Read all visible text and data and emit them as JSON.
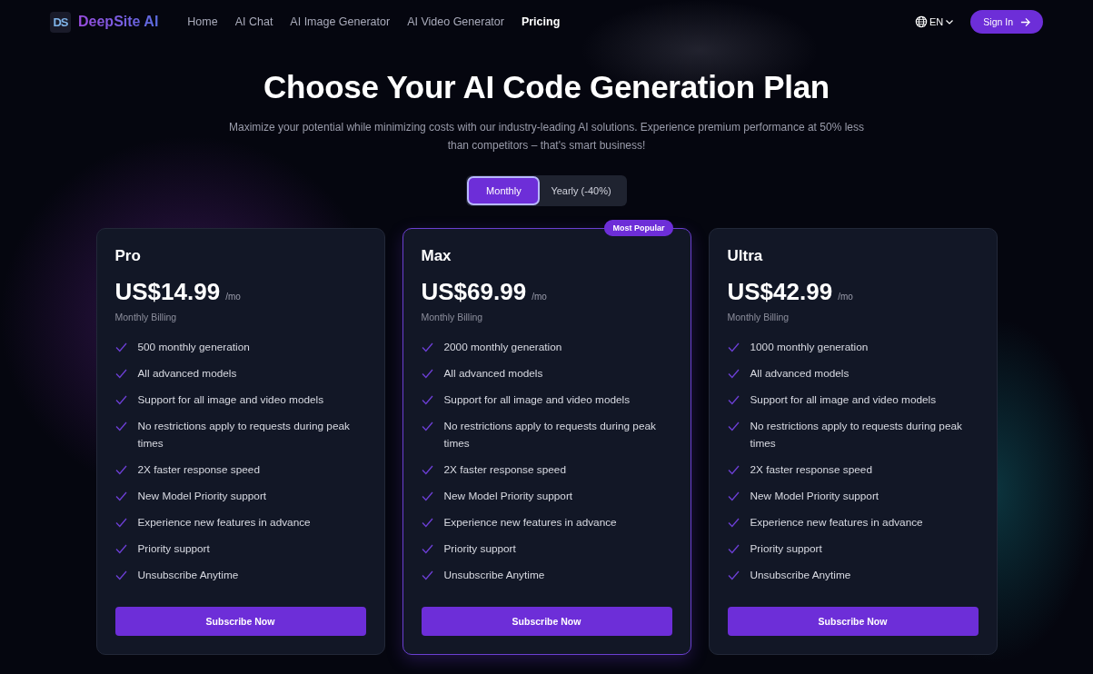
{
  "header": {
    "brand": "DeepSite AI",
    "logo_text": "DS",
    "nav": [
      {
        "label": "Home",
        "selected": false
      },
      {
        "label": "AI Chat",
        "selected": false
      },
      {
        "label": "AI Image Generator",
        "selected": false
      },
      {
        "label": "AI Video Generator",
        "selected": false
      },
      {
        "label": "Pricing",
        "selected": true
      }
    ],
    "language": "EN",
    "sign_in": "Sign In"
  },
  "hero": {
    "title": "Choose Your AI Code Generation Plan",
    "subtitle": "Maximize your potential while minimizing costs with our industry-leading AI solutions. Experience premium performance at 50% less than competitors – that's smart business!"
  },
  "billing_toggle": [
    {
      "label": "Monthly",
      "selected": true
    },
    {
      "label": "Yearly (-40%)",
      "selected": false
    }
  ],
  "plans": [
    {
      "name": "Pro",
      "price": "US$14.99",
      "period": "/mo",
      "billing": "Monthly Billing",
      "featured": false,
      "features": [
        "500 monthly generation",
        "All advanced models",
        "Support for all image and video models",
        "No restrictions apply to requests during peak times",
        "2X faster response speed",
        "New Model Priority support",
        "Experience new features in advance",
        "Priority support",
        "Unsubscribe Anytime"
      ],
      "button": "Subscribe Now"
    },
    {
      "name": "Max",
      "price": "US$69.99",
      "period": "/mo",
      "billing": "Monthly Billing",
      "featured": true,
      "badge": "Most Popular",
      "features": [
        "2000 monthly generation",
        "All advanced models",
        "Support for all image and video models",
        "No restrictions apply to requests during peak times",
        "2X faster response speed",
        "New Model Priority support",
        "Experience new features in advance",
        "Priority support",
        "Unsubscribe Anytime"
      ],
      "button": "Subscribe Now"
    },
    {
      "name": "Ultra",
      "price": "US$42.99",
      "period": "/mo",
      "billing": "Monthly Billing",
      "featured": false,
      "features": [
        "1000 monthly generation",
        "All advanced models",
        "Support for all image and video models",
        "No restrictions apply to requests during peak times",
        "2X faster response speed",
        "New Model Priority support",
        "Experience new features in advance",
        "Priority support",
        "Unsubscribe Anytime"
      ],
      "button": "Subscribe Now"
    }
  ]
}
